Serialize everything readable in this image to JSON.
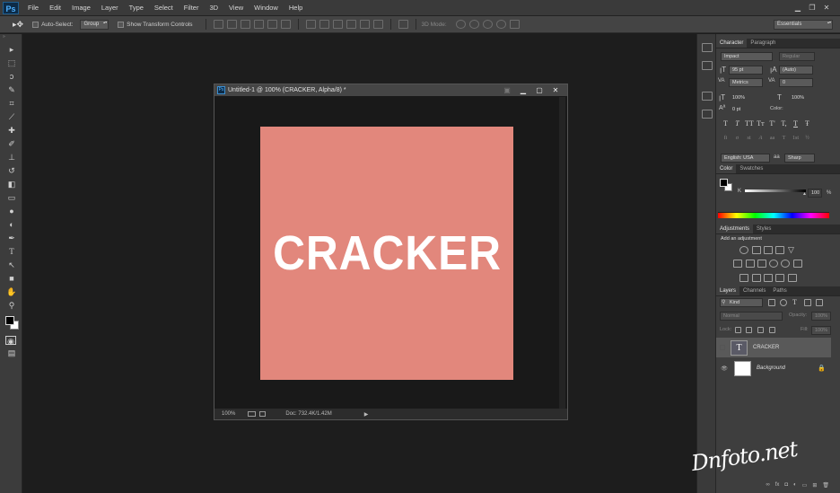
{
  "app": {
    "logo": "Ps"
  },
  "menubar": {
    "items": [
      "File",
      "Edit",
      "Image",
      "Layer",
      "Type",
      "Select",
      "Filter",
      "3D",
      "View",
      "Window",
      "Help"
    ]
  },
  "options": {
    "auto_select_label": "Auto-Select:",
    "group_value": "Group",
    "show_transform_label": "Show Transform Controls",
    "mode3d_label": "3D Mode:",
    "workspace": "Essentials"
  },
  "document": {
    "title": "Untitled-1 @ 100% (CRACKER, Alpha/8) *",
    "canvas_text": "CRACKER",
    "canvas_color": "#e2877c",
    "zoom": "100%",
    "doc_size": "Doc: 732.4K/1.42M"
  },
  "character": {
    "tabs": [
      "Character",
      "Paragraph"
    ],
    "font_family": "Impact",
    "font_style": "Regular",
    "font_size": "95 pt",
    "leading": "(Auto)",
    "kerning": "Metrics",
    "tracking": "0",
    "vscale": "100%",
    "hscale": "100%",
    "baseline": "0 pt",
    "color_label": "Color:",
    "language": "English: USA",
    "aa_label": "aa",
    "antialias": "Sharp",
    "style_glyphs": [
      "T",
      "T",
      "TT",
      "Tт",
      "T'",
      "T,",
      "T",
      "Ŧ"
    ],
    "ot_glyphs": [
      "fi",
      "σ",
      "st",
      "A",
      "aa",
      "T",
      "1st",
      "½"
    ]
  },
  "color_panel": {
    "tabs": [
      "Color",
      "Swatches"
    ],
    "channel": "K",
    "value": "100",
    "unit": "%"
  },
  "adjustments": {
    "tabs": [
      "Adjustments",
      "Styles"
    ],
    "heading": "Add an adjustment"
  },
  "layers": {
    "tabs": [
      "Layers",
      "Channels",
      "Paths"
    ],
    "filter": "Kind",
    "blend_mode": "Normal",
    "opacity_label": "Opacity:",
    "opacity": "100%",
    "lock_label": "Lock:",
    "fill_label": "Fill:",
    "fill": "100%",
    "items": [
      {
        "name": "CRACKER",
        "type": "text"
      },
      {
        "name": "Background",
        "type": "image"
      }
    ]
  },
  "watermark": "Dnfoto.net"
}
